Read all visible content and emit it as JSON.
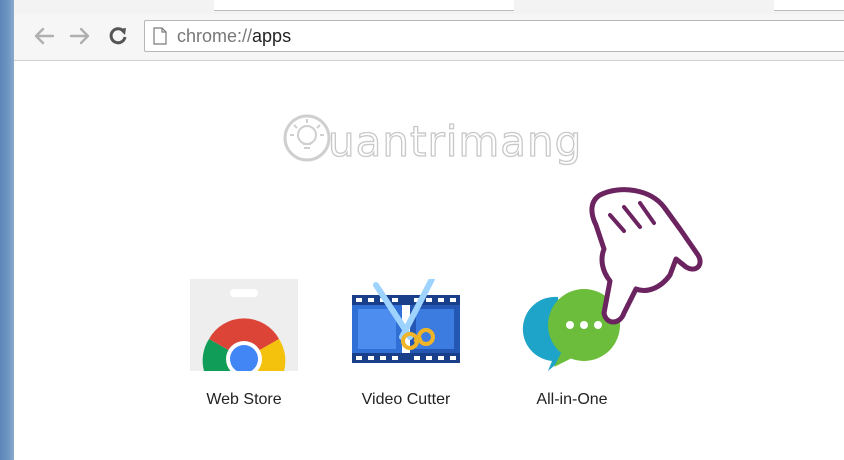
{
  "browser": {
    "url_scheme": "chrome://",
    "url_host": "apps"
  },
  "icons": {
    "back": "back-arrow-icon",
    "forward": "forward-arrow-icon",
    "reload": "reload-icon",
    "page": "page-icon",
    "pointer": "pointing-hand-icon"
  },
  "watermark": {
    "text": "uantrimang"
  },
  "apps": [
    {
      "label": "Web Store"
    },
    {
      "label": "Video Cutter"
    },
    {
      "label": "All-in-One"
    }
  ],
  "colors": {
    "chrome_red": "#db4437",
    "chrome_yellow": "#f4c20d",
    "chrome_green": "#0f9d58",
    "chrome_blue": "#4285f4",
    "film_blue": "#2f6fd6",
    "bubble_teal": "#1ea3c9",
    "bubble_green": "#6cbd3b",
    "hand_outline": "#6b2460"
  }
}
